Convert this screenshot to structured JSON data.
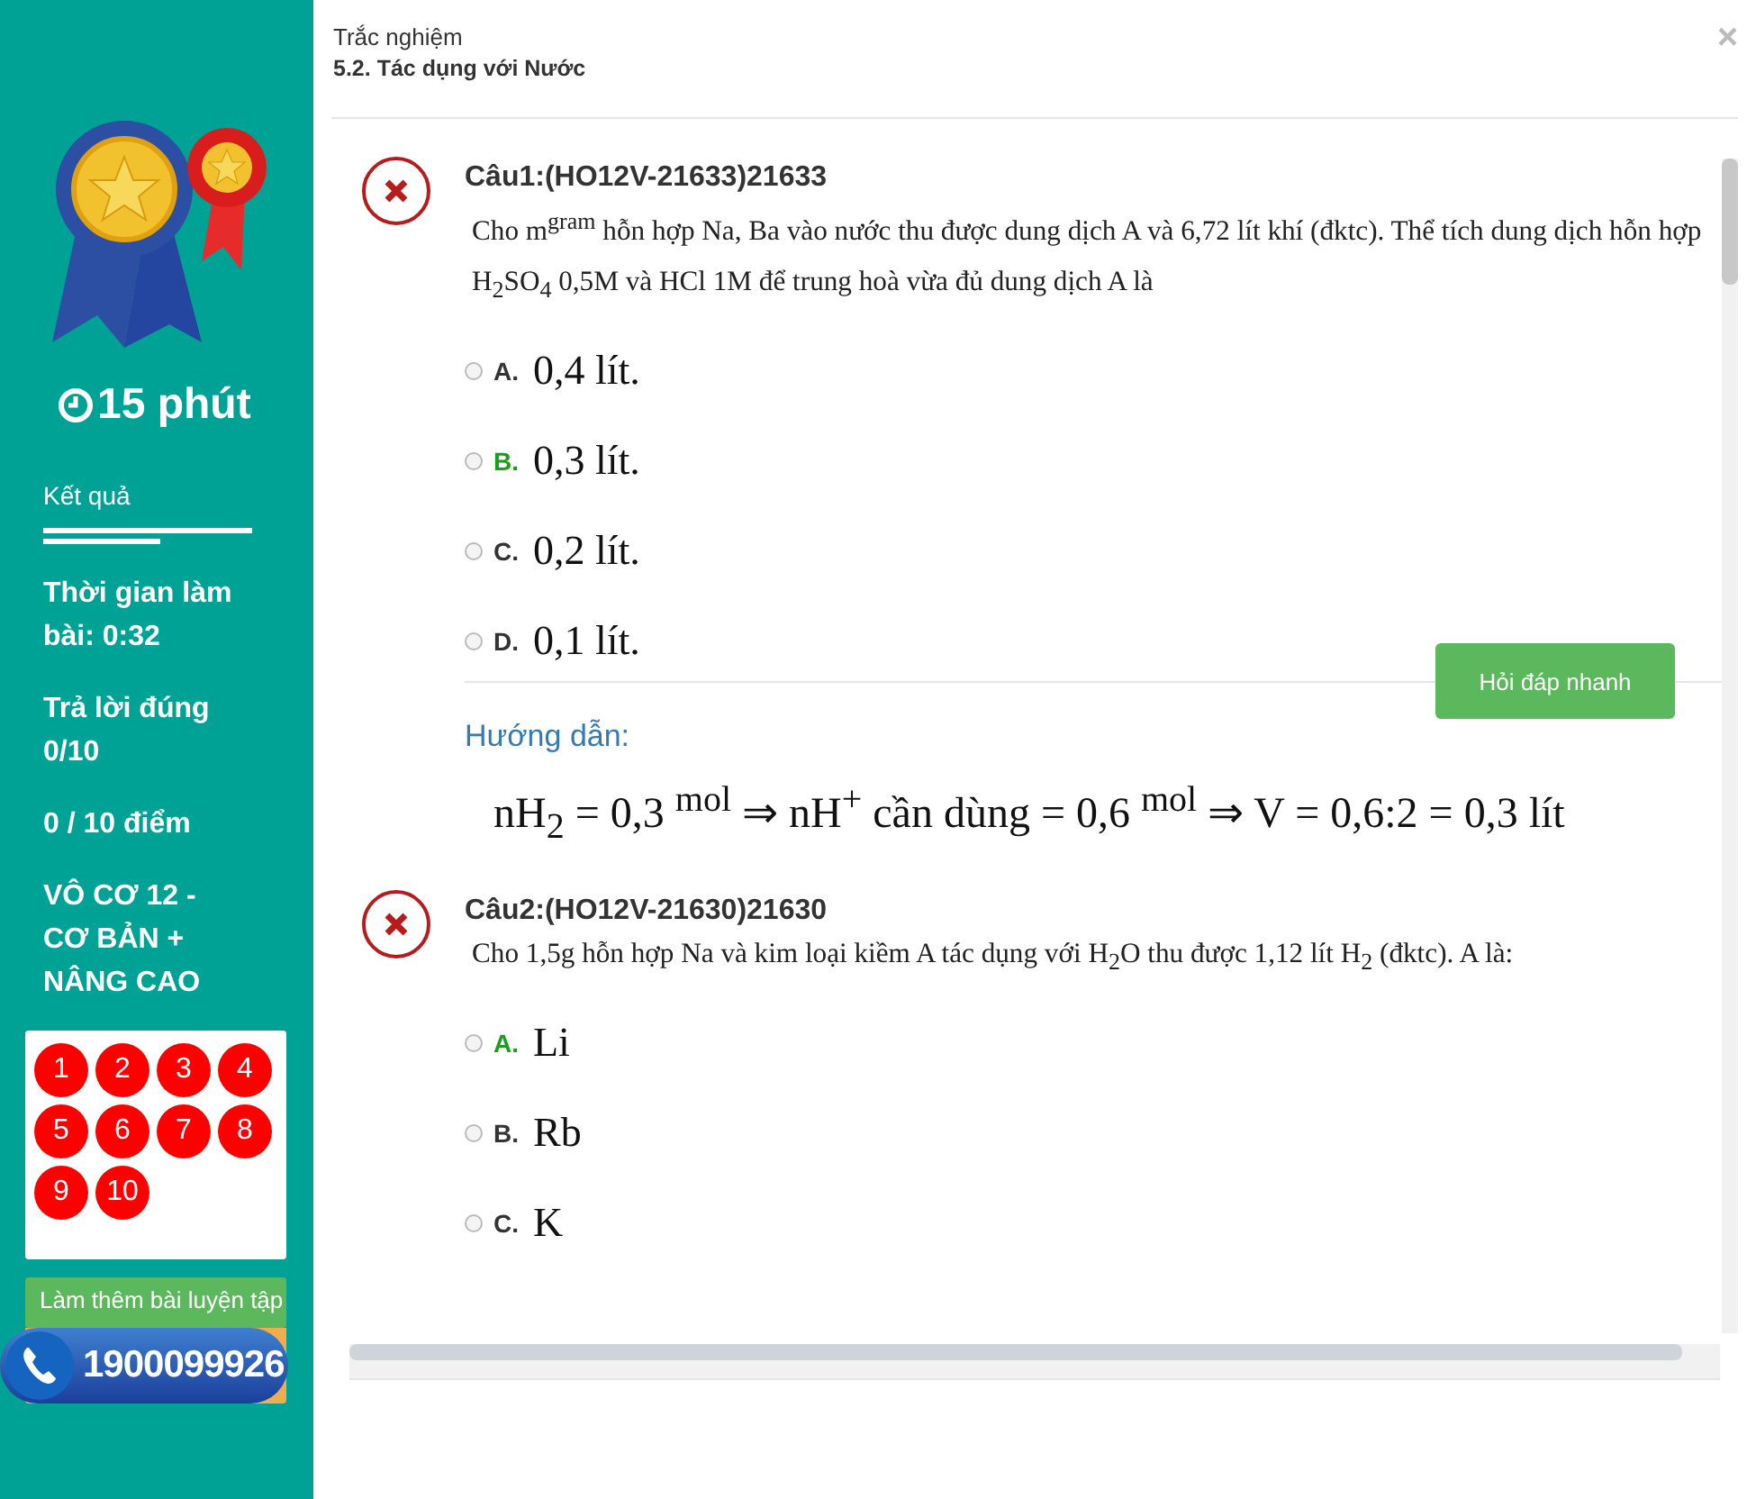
{
  "sidebar": {
    "timer": "15 phút",
    "result_label": "Kết quả",
    "stats": [
      "Thời gian làm bài: 0:32",
      "Trả lời đúng 0/10",
      "0 / 10 điểm",
      "VÔ CƠ 12 - CƠ BẢN + NÂNG CAO"
    ],
    "question_numbers": [
      "1",
      "2",
      "3",
      "4",
      "5",
      "6",
      "7",
      "8",
      "9",
      "10"
    ],
    "practice_button": "Làm thêm bài luyện tập",
    "hotline": "1900099926"
  },
  "modal": {
    "subtitle": "Trắc nghiệm",
    "title": "5.2. Tác dụng với Nước",
    "close": "×"
  },
  "questions": [
    {
      "title": "Câu1:(HO12V-21633)21633",
      "text": "Cho m$^{gram}$ hỗn hợp Na, Ba vào nước thu được dung dịch A và 6,72 lít khí (đktc). Thể tích dung dịch hỗn hợp H$_{2}$SO$_{4}$ 0,5M và HCl 1M để trung hoà vừa đủ dung dịch A là",
      "options": [
        {
          "letter": "A.",
          "text": "0,4 lít.",
          "correct": false,
          "selected": false
        },
        {
          "letter": "B.",
          "text": "0,3 lít.",
          "correct": true,
          "selected": false
        },
        {
          "letter": "C.",
          "text": "0,2 lít.",
          "correct": false,
          "selected": false
        },
        {
          "letter": "D.",
          "text": "0,1 lít.",
          "correct": false,
          "selected": false
        }
      ],
      "ask_button": "Hỏi đáp nhanh",
      "guide_label": "Hướng dẫn:",
      "guide": "nH$_{2}$ = 0,3 $^{mol}$ ⇒ nH$^{+}$ cần dùng = 0,6 $^{mol}$ ⇒ V = 0,6:2 = 0,3 lít"
    },
    {
      "title": "Câu2:(HO12V-21630)21630",
      "text": "Cho 1,5g hỗn hợp  Na và kim loại kiềm A tác dụng với H$_{2}$O thu được 1,12 lít H$_{2}$ (đktc). A là:",
      "options": [
        {
          "letter": "A.",
          "text": "Li",
          "correct": true,
          "selected": false
        },
        {
          "letter": "B.",
          "text": "Rb",
          "correct": false,
          "selected": false
        },
        {
          "letter": "C.",
          "text": "K",
          "correct": false,
          "selected": false
        }
      ]
    }
  ]
}
